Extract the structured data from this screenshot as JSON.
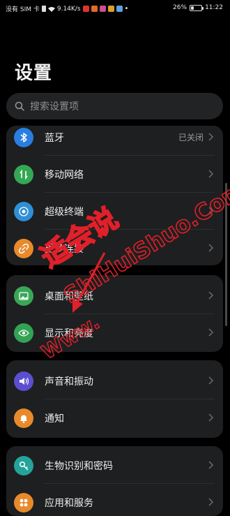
{
  "status_bar": {
    "carrier": "没有 SIM 卡",
    "speed": "9.14K/s",
    "battery_percent": "26%",
    "battery_level": 0.26,
    "time": "11:22"
  },
  "page": {
    "title": "设置"
  },
  "search": {
    "placeholder": "搜索设置项"
  },
  "groups": [
    {
      "items": [
        {
          "label": "蓝牙",
          "value": "已关闭",
          "icon": "bluetooth-icon",
          "color": "#2a7de1"
        },
        {
          "label": "移动网络",
          "value": "",
          "icon": "mobile-network-icon",
          "color": "#34a853"
        },
        {
          "label": "超级终端",
          "value": "",
          "icon": "super-device-icon",
          "color": "#2f8fd7"
        },
        {
          "label": "更多连接",
          "value": "",
          "icon": "link-icon",
          "color": "#e88a2b"
        }
      ]
    },
    {
      "items": [
        {
          "label": "桌面和壁纸",
          "value": "",
          "icon": "wallpaper-icon",
          "color": "#3aa756"
        },
        {
          "label": "显示和亮度",
          "value": "",
          "icon": "eye-icon",
          "color": "#33a253"
        }
      ]
    },
    {
      "items": [
        {
          "label": "声音和振动",
          "value": "",
          "icon": "volume-icon",
          "color": "#5b4fd0"
        },
        {
          "label": "通知",
          "value": "",
          "icon": "bell-icon",
          "color": "#e88a2b"
        }
      ]
    },
    {
      "items": [
        {
          "label": "生物识别和密码",
          "value": "",
          "icon": "key-icon",
          "color": "#24a39b"
        },
        {
          "label": "应用和服务",
          "value": "",
          "icon": "apps-icon",
          "color": "#e88a2b"
        }
      ]
    }
  ],
  "watermark": {
    "brand": "适会说",
    "url": "ShiHuiShuo.Com",
    "prefix": "Www."
  }
}
